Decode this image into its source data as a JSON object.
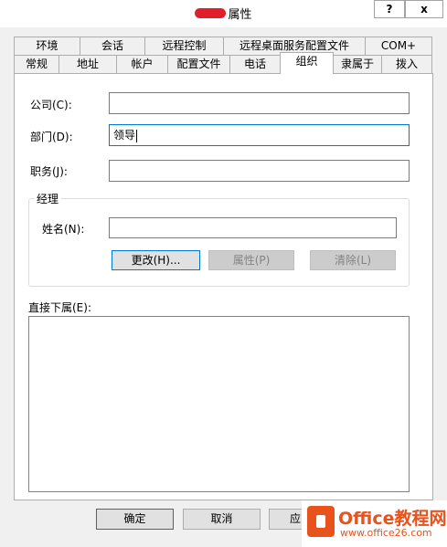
{
  "window": {
    "title": "属性",
    "help_label": "?",
    "close_label": "x"
  },
  "tabs_row1": [
    "环境",
    "会话",
    "远程控制",
    "远程桌面服务配置文件",
    "COM+"
  ],
  "tabs_row2": [
    "常规",
    "地址",
    "帐户",
    "配置文件",
    "电话",
    "组织",
    "隶属于",
    "拨入"
  ],
  "active_tab": "组织",
  "form": {
    "company_label": "公司(C):",
    "company_value": "",
    "department_label": "部门(D):",
    "department_value": "领导",
    "title_label": "职务(J):",
    "title_value": "",
    "manager_group_title": "经理",
    "manager_name_label": "姓名(N):",
    "manager_name_value": "",
    "change_button": "更改(H)...",
    "properties_button": "属性(P)",
    "clear_button": "清除(L)",
    "direct_reports_label": "直接下属(E):"
  },
  "footer": {
    "ok_label": "确定",
    "cancel_label": "取消",
    "apply_label": "应"
  },
  "watermark": {
    "brand": "Office教程网",
    "url": "www.office26.com"
  }
}
